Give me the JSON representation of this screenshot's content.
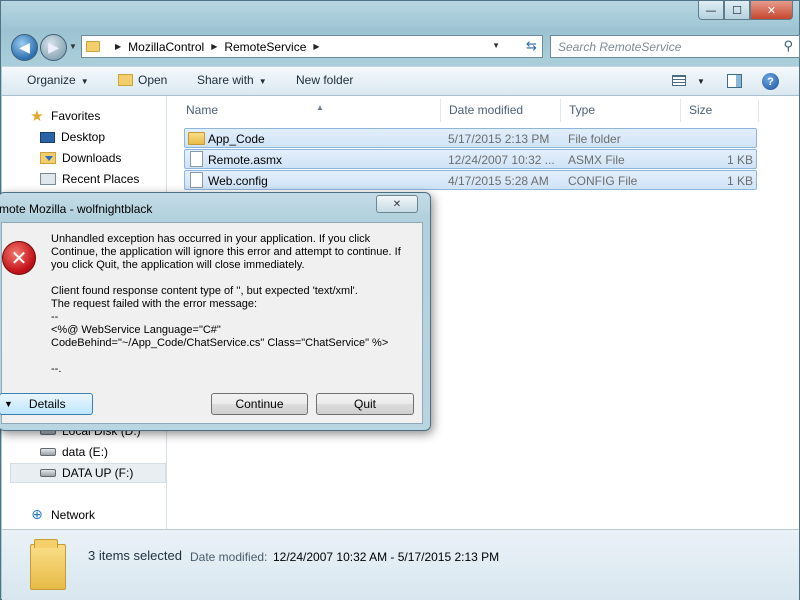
{
  "window": {
    "caption_buttons": {
      "minimize": "—",
      "maximize": "☐",
      "close": "✕"
    }
  },
  "nav": {
    "back_icon": "◀",
    "forward_icon": "▶",
    "breadcrumbs": [
      "MozillaControl",
      "RemoteService"
    ],
    "refresh_icon": "⇆",
    "search_placeholder": "Search RemoteService",
    "search_icon": "⚲"
  },
  "toolbar": {
    "organize": "Organize",
    "open": "Open",
    "share_with": "Share with",
    "new_folder": "New folder",
    "help": "?"
  },
  "navpane": {
    "favorites": "Favorites",
    "desktop": "Desktop",
    "downloads": "Downloads",
    "recent_places": "Recent Places",
    "local_disk": "Local Disk (D:)",
    "data_e": "data (E:)",
    "data_up": "DATA UP (F:)",
    "network": "Network"
  },
  "columns": {
    "name": "Name",
    "date_modified": "Date modified",
    "type": "Type",
    "size": "Size"
  },
  "files": [
    {
      "name": "App_Code",
      "date": "5/17/2015 2:13 PM",
      "type": "File folder",
      "size": "",
      "icon": "folder-icon"
    },
    {
      "name": "Remote.asmx",
      "date": "12/24/2007 10:32 ...",
      "type": "ASMX File",
      "size": "1 KB",
      "icon": "file-icon"
    },
    {
      "name": "Web.config",
      "date": "4/17/2015 5:28 AM",
      "type": "CONFIG File",
      "size": "1 KB",
      "icon": "file-icon"
    }
  ],
  "details": {
    "selection": "3 items selected",
    "date_label": "Date modified:",
    "date_value": "12/24/2007 10:32 AM - 5/17/2015 2:13 PM"
  },
  "dialog": {
    "title": "mote Mozilla - wolfnightblack",
    "close": "✕",
    "error_icon": "✕",
    "message": "Unhandled exception has occurred in your application. If you click\nContinue, the application will ignore this error and attempt to continue. If\nyou click Quit, the application will close immediately.\n\nClient found response content type of '', but expected 'text/xml'.\nThe request failed with the error message:\n--\n<%@ WebService Language=\"C#\"\nCodeBehind=\"~/App_Code/ChatService.cs\" Class=\"ChatService\" %>\n\n--.",
    "details_label": "Details",
    "continue_label": "Continue",
    "quit_label": "Quit"
  }
}
